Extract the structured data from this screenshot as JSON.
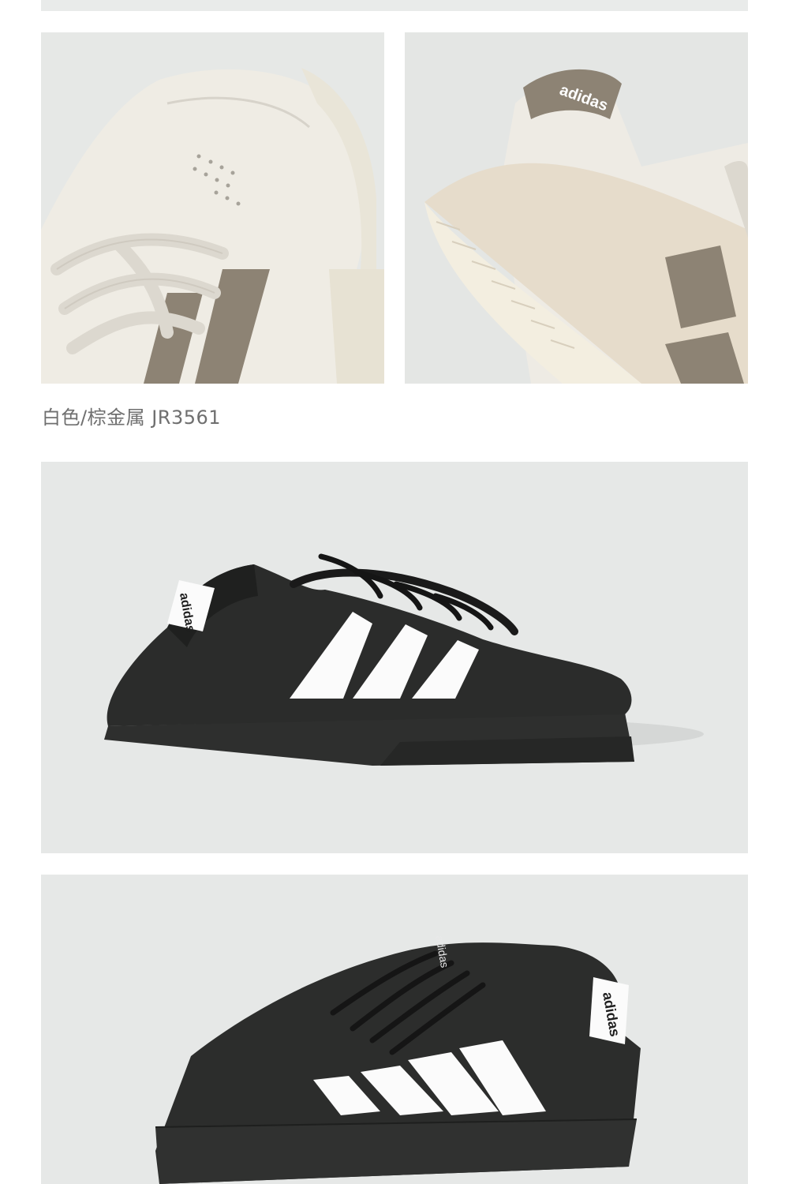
{
  "page": {
    "background": "#ffffff",
    "panel_background": "#e7e9e8"
  },
  "product": {
    "color_caption": "白色/棕金属 JR3561",
    "brand_mark": "adidas",
    "colors": {
      "cream_upper": "#efece5",
      "gold_metallic": "#8d8374",
      "black_upper": "#2b2c2b",
      "black_sole": "#2e2f2e",
      "white_stripe": "#fbfbfb"
    }
  },
  "images": [
    {
      "name": "cream shoe toe and lace detail",
      "icon": "sneaker-detail-icon"
    },
    {
      "name": "cream shoe heel and sole detail",
      "icon": "sneaker-detail-icon"
    },
    {
      "name": "black shoe outer side view",
      "icon": "sneaker-icon"
    },
    {
      "name": "black shoe inner side view",
      "icon": "sneaker-icon"
    }
  ]
}
